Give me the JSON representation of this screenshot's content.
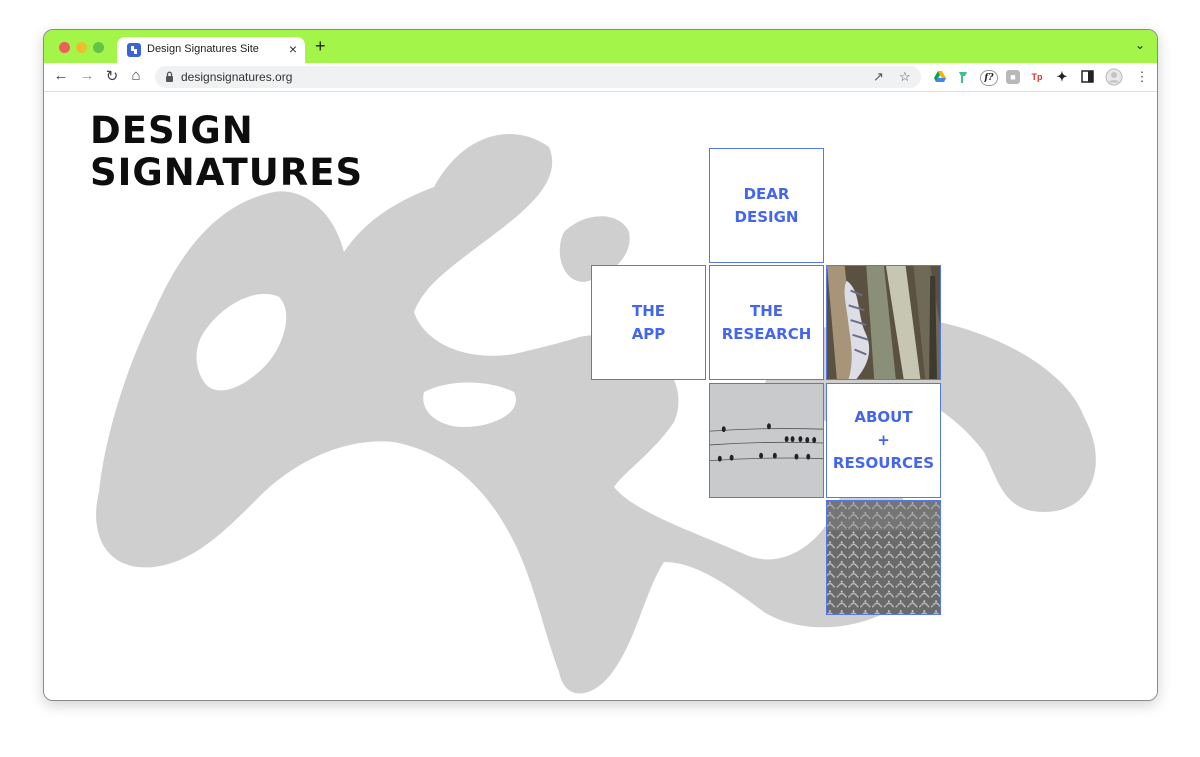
{
  "browser": {
    "tab_title": "Design Signatures Site",
    "tab_close": "×",
    "new_tab": "+",
    "tab_menu": "⌄",
    "url": "designsignatures.org",
    "accent": "#a4f54a",
    "nav_icons": [
      "back-icon",
      "forward-icon",
      "reload-icon",
      "home-icon"
    ],
    "ext_badges": {
      "formula": "f?",
      "tp": "Tp"
    }
  },
  "page": {
    "logo_line1": "DESIGN",
    "logo_line2": "SIGNATURES",
    "link_color": "#4466ee",
    "tiles": {
      "dear_design": "DEAR\nDESIGN",
      "the_app": "THE\nAPP",
      "the_research": "THE\nRESEARCH",
      "about": "ABOUT\n+\nRESOURCES"
    },
    "images": [
      "plant-leaves-image",
      "birds-on-wires-image",
      "textured-surface-image"
    ]
  }
}
